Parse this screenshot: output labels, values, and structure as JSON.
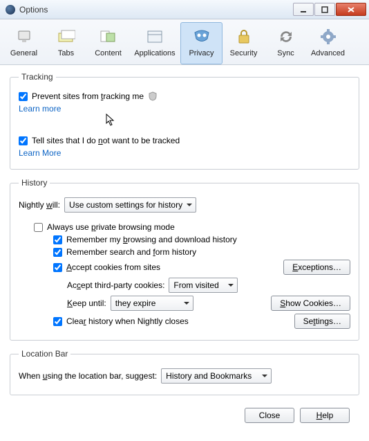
{
  "window": {
    "title": "Options"
  },
  "toolbar": {
    "items": [
      {
        "label": "General"
      },
      {
        "label": "Tabs"
      },
      {
        "label": "Content"
      },
      {
        "label": "Applications"
      },
      {
        "label": "Privacy"
      },
      {
        "label": "Security"
      },
      {
        "label": "Sync"
      },
      {
        "label": "Advanced"
      }
    ],
    "selected": "Privacy"
  },
  "tracking": {
    "legend": "Tracking",
    "prevent_label": "Prevent sites from tracking me",
    "prevent_checked": true,
    "learn_more_1": "Learn more",
    "dnt_label": "Tell sites that I do not want to be tracked",
    "dnt_checked": true,
    "learn_more_2": "Learn More"
  },
  "history": {
    "legend": "History",
    "nightly_will": "Nightly will:",
    "mode_value": "Use custom settings for history",
    "always_private": "Always use private browsing mode",
    "always_private_checked": false,
    "remember_history": "Remember my browsing and download history",
    "remember_history_checked": true,
    "remember_search": "Remember search and form history",
    "remember_search_checked": true,
    "accept_cookies": "Accept cookies from sites",
    "accept_cookies_checked": true,
    "exceptions_btn": "Exceptions…",
    "accept_third": "Accept third-party cookies:",
    "accept_third_value": "From visited",
    "keep_until": "Keep until:",
    "keep_until_value": "they expire",
    "show_cookies_btn": "Show Cookies…",
    "clear_on_close": "Clear history when Nightly closes",
    "clear_on_close_checked": true,
    "settings_btn": "Settings…"
  },
  "locationbar": {
    "legend": "Location Bar",
    "prompt": "When using the location bar, suggest:",
    "value": "History and Bookmarks"
  },
  "footer": {
    "close": "Close",
    "help": "Help"
  }
}
